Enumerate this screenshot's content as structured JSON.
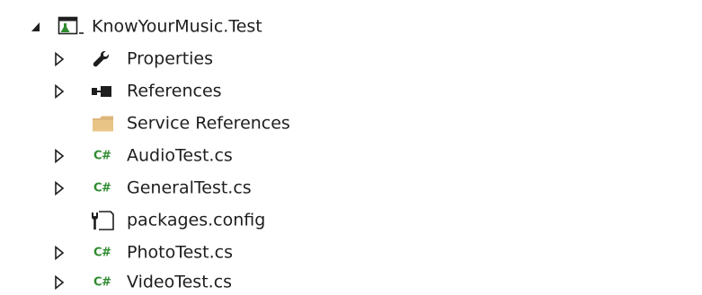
{
  "tree": {
    "root": {
      "label": "KnowYourMusic.Test",
      "icon": "test-project-icon",
      "expanded": true
    },
    "items": [
      {
        "label": "Properties",
        "icon": "wrench-icon",
        "expandable": true
      },
      {
        "label": "References",
        "icon": "references-icon",
        "expandable": true
      },
      {
        "label": "Service References",
        "icon": "folder-icon",
        "expandable": false
      },
      {
        "label": "AudioTest.cs",
        "icon": "csharp-file-icon",
        "icon_text": "C#",
        "expandable": true
      },
      {
        "label": "GeneralTest.cs",
        "icon": "csharp-file-icon",
        "icon_text": "C#",
        "expandable": true
      },
      {
        "label": "packages.config",
        "icon": "config-file-icon",
        "expandable": false
      },
      {
        "label": "PhotoTest.cs",
        "icon": "csharp-file-icon",
        "icon_text": "C#",
        "expandable": true
      },
      {
        "label": "VideoTest.cs",
        "icon": "csharp-file-icon",
        "icon_text": "C#",
        "expandable": true
      }
    ]
  },
  "colors": {
    "text": "#1e1e1e",
    "csharp": "#2e8b2e",
    "folder": "#dcb67a",
    "test_project": "#2e8b2e"
  }
}
